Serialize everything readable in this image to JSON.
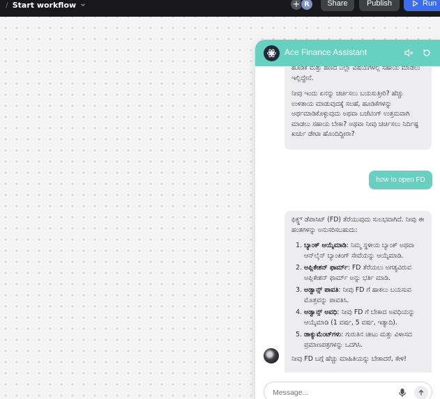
{
  "topbar": {
    "breadcrumb_sep": "/",
    "workflow_title": "Start workflow",
    "avatar_initial": "R",
    "share_label": "Share",
    "publish_label": "Publish",
    "run_label": "Run"
  },
  "chat": {
    "title": "Ace Finance Assistant",
    "accent_color": "#67d1c1",
    "messages": {
      "bot1_p1": "ಹೂಡಿಕೆ ಮತ್ತು ಹಣದ ಎಲ್ಲಾ ವಿಷಯಗಳಲ್ಲಿ ಸಹಾಯ ಮಾಡಲು ಇಲ್ಲಿದ್ದೇನೆ.",
      "bot1_p2": "ನೀವು ಇಂದು ಏನನ್ನು ಚರ್ಚಿಸಲು ಬಯಸುತ್ತೀರಿ? ಹೆಚ್ಚು ಉಳಿತಾಯ ಮಾಡುವುದಕ್ಕೆ ಸಲಹೆ, ಹೂಡಿಕೆಗಳನ್ನು ಅರ್ಥಮಾಡಿಕೊಳ್ಳುವುದು ಅಥವಾ ಬಜೆಟಿಂಗ್ ಉತ್ತಮವಾಗಿ ಮಾಡಲು ಸಹಾಯ ಬೇಕಾ? ಅಥವಾ ನೀವು ಚರ್ಚಿಸಲು ನಿರ್ದಿಷ್ಟ ಖರ್ಚು ಡೇಟಾ ಹೊಂದಿದ್ದೀರಾ?",
      "user1": "how to open FD",
      "bot2_intro": "ಫಿಕ್ಸ್ಡ್ ಡೆಪಾಸಿಟ್ (FD) ತೆರೆಯುವುದು ಸುಲಭವಾಗಿದೆ. ನೀವು ಈ ಹಂತಗಳನ್ನು ಅನುಸರಿಸಬಹುದು:",
      "steps": [
        {
          "title": "ಬ್ಯಾಂಕ್ ಆಯ್ಕೆಮಾಡಿ",
          "text": ": ನಿಮ್ಮ ಸ್ಥಳೀಯ ಬ್ಯಾಂಕ್ ಅಥವಾ ಆನ್‌ಲೈನ್ ಬ್ಯಾಂಕಿಂಗ್ ಸೇವೆಯನ್ನು ಆಯ್ಕೆಮಾಡಿ."
        },
        {
          "title": "ಅಪ್ಲಿಕೇಶನ್ ಫಾರ್ಮ್",
          "text": ": FD ತೆರೆಯಲು ಅಗತ್ಯವಿರುವ ಅಪ್ಲಿಕೇಶನ್ ಫಾರ್ಮ್ ಅನ್ನು ಭರ್ತಿ ಮಾಡಿ."
        },
        {
          "title": "ಅಡ್ವಾನ್ಸ್ ಪಾವತಿ",
          "text": ": ನೀವು FD ಗೆ ಹಾಕಲು ಬಯಸುವ ಮೊತ್ತವನ್ನು ಪಾವತಿಸಿ."
        },
        {
          "title": "ಅಡ್ವಾನ್ಸ್ ಅವಧಿ",
          "text": ": ನೀವು FD ಗೆ ಬೇಕಾದ ಅವಧಿಯನ್ನು ಆಯ್ಕೆಮಾಡಿ (1 ವರ್ಷ, 5 ವರ್ಷ, ಇತ್ಯಾದಿ)."
        },
        {
          "title": "ಡಾಕ್ಯುಮೆಂಟ್‌ಗಳು",
          "text": ": ಗುರುತಿನ ಚೀಟು ಮತ್ತು ವಿಳಾಸದ ಪ್ರಮಾಣಪತ್ರಗಳನ್ನು ಒದಗಿಸಿ."
        }
      ],
      "bot2_outro": "ನೀವು FD ಬಗ್ಗೆ ಹೆಚ್ಚು ಮಾಹಿತಿಯನ್ನು ಬೇಕಾದರೆ, ಕೇಳಿ!"
    },
    "input_placeholder": "Message..."
  }
}
